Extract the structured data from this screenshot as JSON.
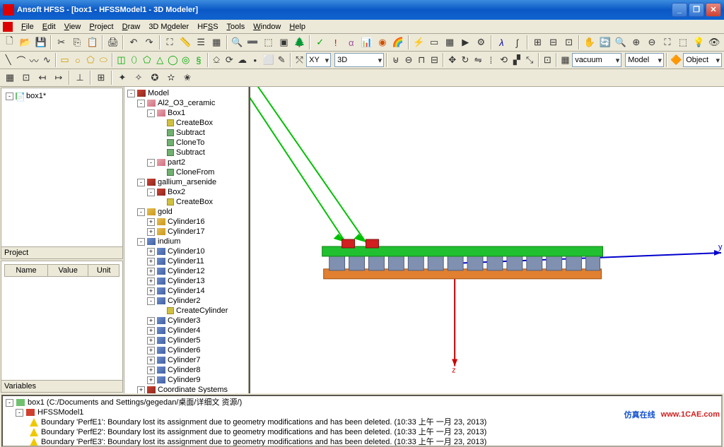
{
  "title": "Ansoft HFSS - [box1 - HFSSModel1 - 3D Modeler]",
  "window_buttons": {
    "min": "_",
    "max": "❐",
    "close": "✕"
  },
  "menu": [
    "File",
    "Edit",
    "View",
    "Project",
    "Draw",
    "3D Modeler",
    "HFSS",
    "Tools",
    "Window",
    "Help"
  ],
  "combo": {
    "plane": "XY",
    "mode": "3D",
    "material": "vacuum",
    "scope": "Model",
    "select": "Object"
  },
  "left": {
    "project_tree_root": "box1*",
    "project_label": "Project",
    "prop_headers": [
      "Name",
      "Value",
      "Unit"
    ],
    "variables_label": "Variables"
  },
  "model_tree": {
    "root": "Model",
    "groups": [
      {
        "name": "Al2_O3_ceramic",
        "color": "cube-pink",
        "children": [
          {
            "name": "Box1",
            "color": "cube-pink",
            "ops": [
              "CreateBox",
              "Subtract",
              "CloneTo",
              "Subtract"
            ]
          },
          {
            "name": "part2",
            "color": "cube-pink",
            "ops": [
              "CloneFrom"
            ]
          }
        ]
      },
      {
        "name": "gallium_arsenide",
        "color": "cube",
        "children": [
          {
            "name": "Box2",
            "color": "cube",
            "ops": [
              "CreateBox"
            ]
          }
        ]
      },
      {
        "name": "gold",
        "color": "cube-gold",
        "children": [
          {
            "name": "Cylinder16",
            "color": "cube-gold",
            "ops": []
          },
          {
            "name": "Cylinder17",
            "color": "cube-gold",
            "ops": []
          }
        ]
      },
      {
        "name": "indium",
        "color": "cube-blue",
        "children": [
          {
            "name": "Cylinder10",
            "color": "cube-blue",
            "ops": []
          },
          {
            "name": "Cylinder11",
            "color": "cube-blue",
            "ops": []
          },
          {
            "name": "Cylinder12",
            "color": "cube-blue",
            "ops": []
          },
          {
            "name": "Cylinder13",
            "color": "cube-blue",
            "ops": []
          },
          {
            "name": "Cylinder14",
            "color": "cube-blue",
            "ops": []
          },
          {
            "name": "Cylinder2",
            "color": "cube-blue",
            "ops": [
              "CreateCylinder"
            ]
          },
          {
            "name": "Cylinder3",
            "color": "cube-blue",
            "ops": []
          },
          {
            "name": "Cylinder4",
            "color": "cube-blue",
            "ops": []
          },
          {
            "name": "Cylinder5",
            "color": "cube-blue",
            "ops": []
          },
          {
            "name": "Cylinder6",
            "color": "cube-blue",
            "ops": []
          },
          {
            "name": "Cylinder7",
            "color": "cube-blue",
            "ops": []
          },
          {
            "name": "Cylinder8",
            "color": "cube-blue",
            "ops": []
          },
          {
            "name": "Cylinder9",
            "color": "cube-blue",
            "ops": []
          }
        ]
      }
    ],
    "coord": "Coordinate Systems"
  },
  "messages": {
    "root": "box1 (C:/Documents and Settings/gegedan/桌面/详细文 资源/)",
    "design": "HFSSModel1",
    "warnings": [
      "Boundary 'PerfE1': Boundary lost its assignment due to geometry modifications and has been deleted.  (10:33 上午  一月 23, 2013)",
      "Boundary 'PerfE2': Boundary lost its assignment due to geometry modifications and has been deleted.  (10:33 上午  一月 23, 2013)",
      "Boundary 'PerfE3': Boundary lost its assignment due to geometry modifications and has been deleted.  (10:33 上午  一月 23, 2013)"
    ]
  },
  "watermark": {
    "cn": "仿真在线",
    "url": "www.1CAE.com"
  },
  "axis": {
    "y": "y",
    "z": "z"
  }
}
